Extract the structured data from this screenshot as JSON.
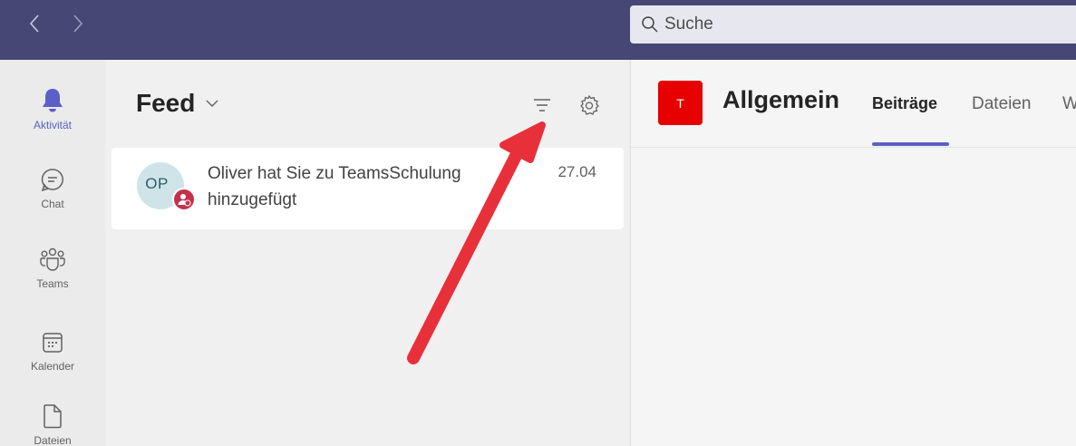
{
  "topbar": {
    "back_icon": "chevron-left-icon",
    "forward_icon": "chevron-right-icon",
    "search_placeholder": "Suche"
  },
  "appbar": {
    "items": [
      {
        "label": "Aktivität",
        "icon": "bell-icon",
        "active": true
      },
      {
        "label": "Chat",
        "icon": "chat-icon"
      },
      {
        "label": "Teams",
        "icon": "teams-icon"
      },
      {
        "label": "Kalender",
        "icon": "calendar-icon"
      },
      {
        "label": "Dateien",
        "icon": "file-icon"
      }
    ]
  },
  "feed": {
    "title": "Feed",
    "filter_icon": "filter-icon",
    "settings_icon": "gear-icon",
    "items": [
      {
        "avatar_initials": "OP",
        "line1": "Oliver hat Sie zu TeamsSchulung",
        "line2": "hinzugefügt",
        "date": "27.04"
      }
    ]
  },
  "channel": {
    "team_initial": "T",
    "name": "Allgemein",
    "tabs": [
      "Beiträge",
      "Dateien",
      "W"
    ]
  },
  "colors": {
    "topbar": "#464775",
    "accent": "#5b5fc7",
    "team_avatar": "#e60000",
    "annotation_arrow": "#e8303b"
  }
}
